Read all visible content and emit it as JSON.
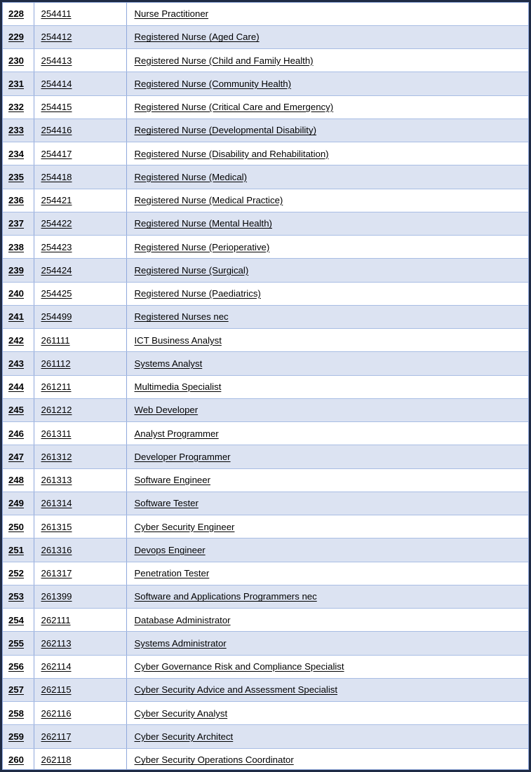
{
  "document": {
    "kind": "occupation-code-table",
    "frame_color": "#1f2b45",
    "band_color": "#dce3f2",
    "grid_line_color": "#8fa8dc",
    "text_color": "#000000"
  },
  "table": {
    "columns": [
      "index",
      "code",
      "occupation"
    ],
    "rows": [
      {
        "index": "228",
        "code": "254411",
        "occupation": "Nurse Practitioner"
      },
      {
        "index": "229",
        "code": "254412",
        "occupation": "Registered Nurse (Aged Care)"
      },
      {
        "index": "230",
        "code": "254413",
        "occupation": "Registered Nurse (Child and Family Health)"
      },
      {
        "index": "231",
        "code": "254414",
        "occupation": "Registered Nurse (Community Health)"
      },
      {
        "index": "232",
        "code": "254415",
        "occupation": "Registered Nurse (Critical Care and Emergency)"
      },
      {
        "index": "233",
        "code": "254416",
        "occupation": "Registered Nurse (Developmental Disability)"
      },
      {
        "index": "234",
        "code": "254417",
        "occupation": "Registered Nurse (Disability and Rehabilitation)"
      },
      {
        "index": "235",
        "code": "254418",
        "occupation": "Registered Nurse (Medical)"
      },
      {
        "index": "236",
        "code": "254421",
        "occupation": "Registered Nurse (Medical Practice)"
      },
      {
        "index": "237",
        "code": "254422",
        "occupation": "Registered Nurse (Mental Health)"
      },
      {
        "index": "238",
        "code": "254423",
        "occupation": "Registered Nurse (Perioperative)"
      },
      {
        "index": "239",
        "code": "254424",
        "occupation": "Registered Nurse (Surgical)"
      },
      {
        "index": "240",
        "code": "254425",
        "occupation": "Registered Nurse (Paediatrics)"
      },
      {
        "index": "241",
        "code": "254499",
        "occupation": "Registered Nurses nec"
      },
      {
        "index": "242",
        "code": "261111",
        "occupation": "ICT Business Analyst"
      },
      {
        "index": "243",
        "code": "261112",
        "occupation": "Systems Analyst"
      },
      {
        "index": "244",
        "code": "261211",
        "occupation": "Multimedia Specialist"
      },
      {
        "index": "245",
        "code": "261212",
        "occupation": "Web Developer"
      },
      {
        "index": "246",
        "code": "261311",
        "occupation": "Analyst Programmer"
      },
      {
        "index": "247",
        "code": "261312",
        "occupation": "Developer Programmer"
      },
      {
        "index": "248",
        "code": "261313",
        "occupation": "Software Engineer"
      },
      {
        "index": "249",
        "code": "261314",
        "occupation": "Software Tester"
      },
      {
        "index": "250",
        "code": "261315",
        "occupation": "Cyber Security Engineer"
      },
      {
        "index": "251",
        "code": "261316",
        "occupation": "Devops Engineer"
      },
      {
        "index": "252",
        "code": "261317",
        "occupation": "Penetration Tester"
      },
      {
        "index": "253",
        "code": "261399",
        "occupation": "Software and Applications Programmers nec"
      },
      {
        "index": "254",
        "code": "262111",
        "occupation": "Database Administrator"
      },
      {
        "index": "255",
        "code": "262113",
        "occupation": "Systems Administrator"
      },
      {
        "index": "256",
        "code": "262114",
        "occupation": "Cyber Governance Risk and Compliance Specialist"
      },
      {
        "index": "257",
        "code": "262115",
        "occupation": "Cyber Security Advice and Assessment Specialist"
      },
      {
        "index": "258",
        "code": "262116",
        "occupation": "Cyber Security Analyst"
      },
      {
        "index": "259",
        "code": "262117",
        "occupation": "Cyber Security Architect"
      },
      {
        "index": "260",
        "code": "262118",
        "occupation": "Cyber Security Operations Coordinator"
      }
    ]
  }
}
